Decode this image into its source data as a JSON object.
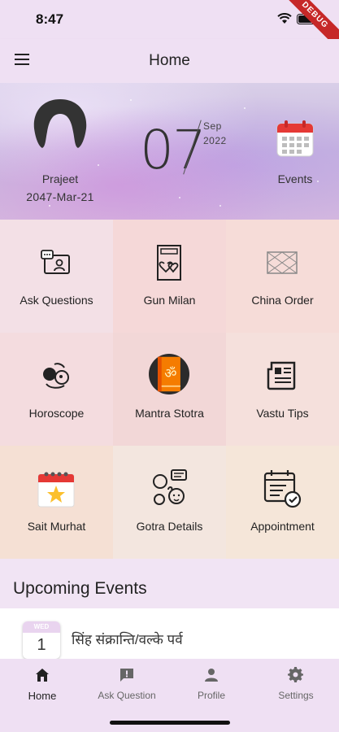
{
  "status_bar": {
    "time": "8:47",
    "debug_label": "DEBUG"
  },
  "app_bar": {
    "title": "Home",
    "menu_icon": "menu-icon"
  },
  "hero": {
    "user_name": "Prajeet",
    "user_date": "2047-Mar-21",
    "day": "07",
    "month": "Sep",
    "year": "2022",
    "events_label": "Events"
  },
  "tiles": [
    {
      "label": "Ask Questions",
      "icon": "chat-person-icon",
      "bg": "#f3e0e6"
    },
    {
      "label": "Gun Milan",
      "icon": "hearts-card-icon",
      "bg": "#f5d8d8"
    },
    {
      "label": "China Order",
      "icon": "chart-grid-icon",
      "bg": "#f6dcd8"
    },
    {
      "label": "Horoscope",
      "icon": "zodiac-icon",
      "bg": "#f4dcdf"
    },
    {
      "label": "Mantra Stotra",
      "icon": "om-book-icon",
      "bg": "#f2d7d7"
    },
    {
      "label": "Vastu Tips",
      "icon": "newspaper-icon",
      "bg": "#f5e0dc"
    },
    {
      "label": "Sait Murhat",
      "icon": "calendar-star-icon",
      "bg": "#f5e0d4"
    },
    {
      "label": "Gotra Details",
      "icon": "family-faces-icon",
      "bg": "#f3e6df"
    },
    {
      "label": "Appointment",
      "icon": "calendar-check-icon",
      "bg": "#f5e6d9"
    }
  ],
  "upcoming": {
    "title": "Upcoming Events",
    "events": [
      {
        "weekday": "WED",
        "day": "1",
        "name": "सिंह संक्रान्ति/वल्के पर्व"
      }
    ]
  },
  "bottom_nav": [
    {
      "label": "Home",
      "icon": "home-icon",
      "active": true
    },
    {
      "label": "Ask Question",
      "icon": "chat-alert-icon",
      "active": false
    },
    {
      "label": "Profile",
      "icon": "person-icon",
      "active": false
    },
    {
      "label": "Settings",
      "icon": "gear-icon",
      "active": false
    }
  ]
}
